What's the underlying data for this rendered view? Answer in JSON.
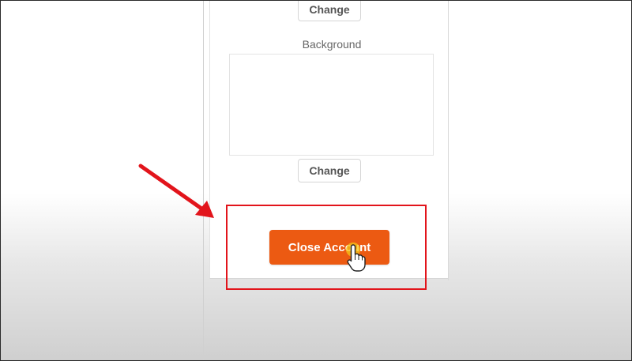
{
  "profile": {
    "avatar_change_label": "Change",
    "background_label": "Background",
    "background_change_label": "Change"
  },
  "account": {
    "close_account_label": "Close Account",
    "close_account_color": "#ec5a12"
  },
  "annotation": {
    "highlight_color": "#e2141b",
    "arrow_icon": "red-arrow-icon"
  },
  "cursor": {
    "icon": "hand-pointer-icon",
    "click_highlight_color": "#f5c518"
  }
}
